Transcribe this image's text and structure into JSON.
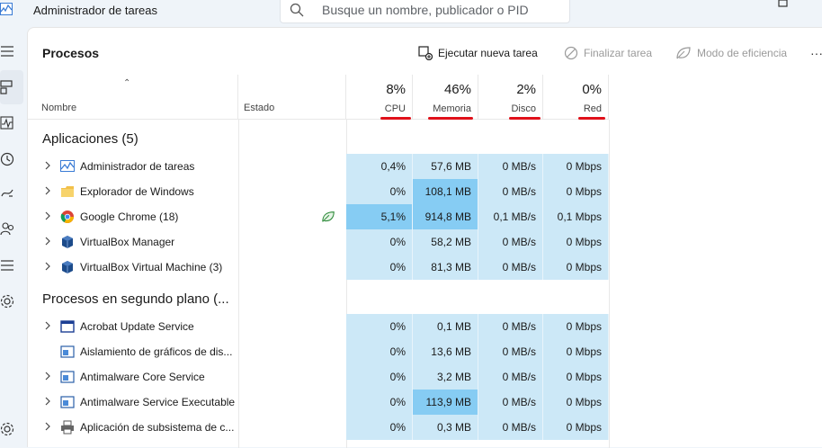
{
  "window": {
    "title": "Administrador de tareas"
  },
  "search": {
    "placeholder": "Busque un nombre, publicador o PID"
  },
  "toolbar": {
    "page_title": "Procesos",
    "new_task": "Ejecutar nueva tarea",
    "end_task": "Finalizar tarea",
    "efficiency": "Modo de eficiencia"
  },
  "columns": {
    "name": "Nombre",
    "status": "Estado",
    "cpu": {
      "pct": "8%",
      "label": "CPU"
    },
    "memory": {
      "pct": "46%",
      "label": "Memoria"
    },
    "disk": {
      "pct": "2%",
      "label": "Disco"
    },
    "network": {
      "pct": "0%",
      "label": "Red"
    }
  },
  "groups": {
    "apps": {
      "title": "Aplicaciones (5)"
    },
    "background": {
      "title": "Procesos en segundo plano (..."
    }
  },
  "apps": [
    {
      "name": "Administrador de tareas",
      "cpu": "0,4%",
      "mem": "57,6 MB",
      "disk": "0 MB/s",
      "net": "0 Mbps"
    },
    {
      "name": "Explorador de Windows",
      "cpu": "0%",
      "mem": "108,1 MB",
      "disk": "0 MB/s",
      "net": "0 Mbps"
    },
    {
      "name": "Google Chrome (18)",
      "cpu": "5,1%",
      "mem": "914,8 MB",
      "disk": "0,1 MB/s",
      "net": "0,1 Mbps"
    },
    {
      "name": "VirtualBox Manager",
      "cpu": "0%",
      "mem": "58,2 MB",
      "disk": "0 MB/s",
      "net": "0 Mbps"
    },
    {
      "name": "VirtualBox Virtual Machine (3)",
      "cpu": "0%",
      "mem": "81,3 MB",
      "disk": "0 MB/s",
      "net": "0 Mbps"
    }
  ],
  "background": [
    {
      "name": "Acrobat Update Service",
      "cpu": "0%",
      "mem": "0,1 MB",
      "disk": "0 MB/s",
      "net": "0 Mbps"
    },
    {
      "name": "Aislamiento de gráficos de dis...",
      "cpu": "0%",
      "mem": "13,6 MB",
      "disk": "0 MB/s",
      "net": "0 Mbps"
    },
    {
      "name": "Antimalware Core Service",
      "cpu": "0%",
      "mem": "3,2 MB",
      "disk": "0 MB/s",
      "net": "0 Mbps"
    },
    {
      "name": "Antimalware Service Executable",
      "cpu": "0%",
      "mem": "113,9 MB",
      "disk": "0 MB/s",
      "net": "0 Mbps"
    },
    {
      "name": "Aplicación de subsistema de c...",
      "cpu": "0%",
      "mem": "0,3 MB",
      "disk": "0 MB/s",
      "net": "0 Mbps"
    }
  ],
  "colors": {
    "cell": "#cce8f7",
    "highlight": "#86ccf3",
    "annotation": "#e0101a"
  }
}
